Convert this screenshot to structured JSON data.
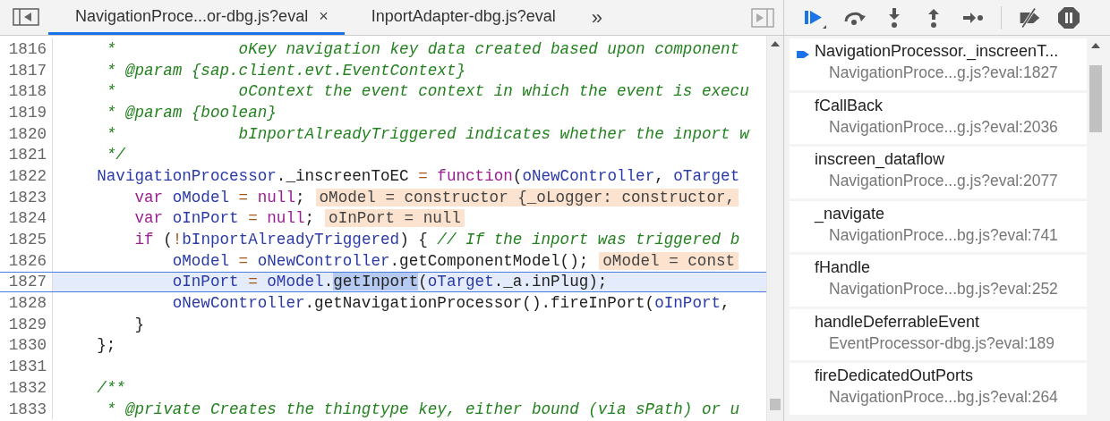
{
  "editor": {
    "tabs": [
      {
        "label": "NavigationProce...or-dbg.js?eval",
        "close": "×",
        "selected": true
      },
      {
        "label": "InportAdapter-dbg.js?eval",
        "selected": false
      }
    ],
    "more_tabs": "»",
    "lines": [
      {
        "number": "1816",
        "current": false,
        "tokens": [
          {
            "kind": "comment",
            "text": "     *             oKey navigation key data created based upon component"
          }
        ]
      },
      {
        "number": "1817",
        "current": false,
        "tokens": [
          {
            "kind": "comment",
            "text": "     * @param {sap.client.evt.EventContext}"
          }
        ]
      },
      {
        "number": "1818",
        "current": false,
        "tokens": [
          {
            "kind": "comment",
            "text": "     *             oContext the event context in which the event is execu"
          }
        ]
      },
      {
        "number": "1819",
        "current": false,
        "tokens": [
          {
            "kind": "comment",
            "text": "     * @param {boolean}"
          }
        ]
      },
      {
        "number": "1820",
        "current": false,
        "tokens": [
          {
            "kind": "comment",
            "text": "     *             bInportAlreadyTriggered indicates whether the inport w"
          }
        ]
      },
      {
        "number": "1821",
        "current": false,
        "tokens": [
          {
            "kind": "comment",
            "text": "     */"
          }
        ]
      },
      {
        "number": "1822",
        "current": false,
        "tokens": [
          {
            "kind": "name",
            "text": "    NavigationProcessor"
          },
          {
            "kind": "text",
            "text": "._inscreenToEC "
          },
          {
            "kind": "op",
            "text": "="
          },
          {
            "kind": "keyword",
            "text": " function"
          },
          {
            "kind": "text",
            "text": "("
          },
          {
            "kind": "name",
            "text": "oNewController"
          },
          {
            "kind": "text",
            "text": ", "
          },
          {
            "kind": "name",
            "text": "oTarget"
          }
        ]
      },
      {
        "number": "1823",
        "current": false,
        "tokens": [
          {
            "kind": "keyword",
            "text": "        var"
          },
          {
            "kind": "name",
            "text": " oModel"
          },
          {
            "kind": "op",
            "text": " = "
          },
          {
            "kind": "keyword",
            "text": "null"
          },
          {
            "kind": "text",
            "text": ";"
          }
        ],
        "inline_value": "oModel = constructor {_oLogger: constructor,"
      },
      {
        "number": "1824",
        "current": false,
        "tokens": [
          {
            "kind": "keyword",
            "text": "        var"
          },
          {
            "kind": "name",
            "text": " oInPort"
          },
          {
            "kind": "op",
            "text": " = "
          },
          {
            "kind": "keyword",
            "text": "null"
          },
          {
            "kind": "text",
            "text": ";"
          }
        ],
        "inline_value": "oInPort = null"
      },
      {
        "number": "1825",
        "current": false,
        "tokens": [
          {
            "kind": "keyword",
            "text": "        if"
          },
          {
            "kind": "text",
            "text": " ("
          },
          {
            "kind": "op",
            "text": "!"
          },
          {
            "kind": "name",
            "text": "bInportAlreadyTriggered"
          },
          {
            "kind": "text",
            "text": ") { "
          },
          {
            "kind": "comment",
            "text": "// If the inport was triggered b"
          }
        ]
      },
      {
        "number": "1826",
        "current": false,
        "tokens": [
          {
            "kind": "name",
            "text": "            oModel"
          },
          {
            "kind": "op",
            "text": " = "
          },
          {
            "kind": "name",
            "text": "oNewController"
          },
          {
            "kind": "text",
            "text": ".getComponentModel();"
          }
        ],
        "inline_value": "oModel = const"
      },
      {
        "number": "1827",
        "current": true,
        "tokens": [
          {
            "kind": "name",
            "text": "            oInPort"
          },
          {
            "kind": "op",
            "text": " = "
          },
          {
            "kind": "name",
            "text": "oModel"
          },
          {
            "kind": "text",
            "text": "."
          },
          {
            "kind": "selection",
            "text": "getInport"
          },
          {
            "kind": "text",
            "text": "("
          },
          {
            "kind": "name",
            "text": "oTarget"
          },
          {
            "kind": "text",
            "text": "._a.inPlug);"
          }
        ]
      },
      {
        "number": "1828",
        "current": false,
        "tokens": [
          {
            "kind": "name",
            "text": "            oNewController"
          },
          {
            "kind": "text",
            "text": ".getNavigationProcessor().fireInPort("
          },
          {
            "kind": "name",
            "text": "oInPort"
          },
          {
            "kind": "text",
            "text": ","
          }
        ]
      },
      {
        "number": "1829",
        "current": false,
        "tokens": [
          {
            "kind": "text",
            "text": "        }"
          }
        ]
      },
      {
        "number": "1830",
        "current": false,
        "tokens": [
          {
            "kind": "text",
            "text": "    };"
          }
        ]
      },
      {
        "number": "1831",
        "current": false
      },
      {
        "number": "1832",
        "current": false,
        "tokens": [
          {
            "kind": "comment",
            "text": "    /**"
          }
        ]
      },
      {
        "number": "1833",
        "current": false,
        "tokens": [
          {
            "kind": "comment",
            "text": "     * @private Creates the thingtype key, either bound (via sPath) or u"
          }
        ]
      }
    ]
  },
  "call_stack": [
    {
      "function": "NavigationProcessor._inscreenT...",
      "location": "NavigationProce...g.js?eval:1827",
      "selected": true
    },
    {
      "function": "fCallBack",
      "location": "NavigationProce...g.js?eval:2036",
      "selected": false
    },
    {
      "function": "inscreen_dataflow",
      "location": "NavigationProce...g.js?eval:2077",
      "selected": false
    },
    {
      "function": "_navigate",
      "location": "NavigationProce...bg.js?eval:741",
      "selected": false
    },
    {
      "function": "fHandle",
      "location": "NavigationProce...bg.js?eval:252",
      "selected": false
    },
    {
      "function": "handleDeferrableEvent",
      "location": "EventProcessor-dbg.js?eval:189",
      "selected": false
    },
    {
      "function": "fireDedicatedOutPorts",
      "location": "NavigationProce...bg.js?eval:264",
      "selected": false
    }
  ]
}
